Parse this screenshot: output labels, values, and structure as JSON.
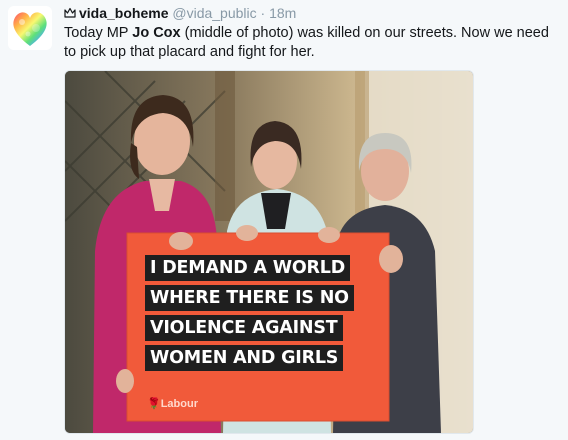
{
  "tweet": {
    "display_name": "vida_boheme",
    "handle": "@vida_public",
    "separator": "·",
    "time": "18m",
    "text_before": "Today MP ",
    "text_bold": "Jo Cox",
    "text_after": " (middle of photo) was killed on our streets. Now we need to pick up that placard and fight for her."
  },
  "media": {
    "placard_lines": [
      "I DEMAND A WORLD",
      "WHERE THERE IS NO",
      "VIOLENCE AGAINST",
      "WOMEN AND GIRLS"
    ],
    "party_logo_text": "Labour",
    "placard_color": "#f15a3a"
  },
  "icons": {
    "crown": "crown-icon",
    "avatar": "rainbow-heart-avatar"
  }
}
